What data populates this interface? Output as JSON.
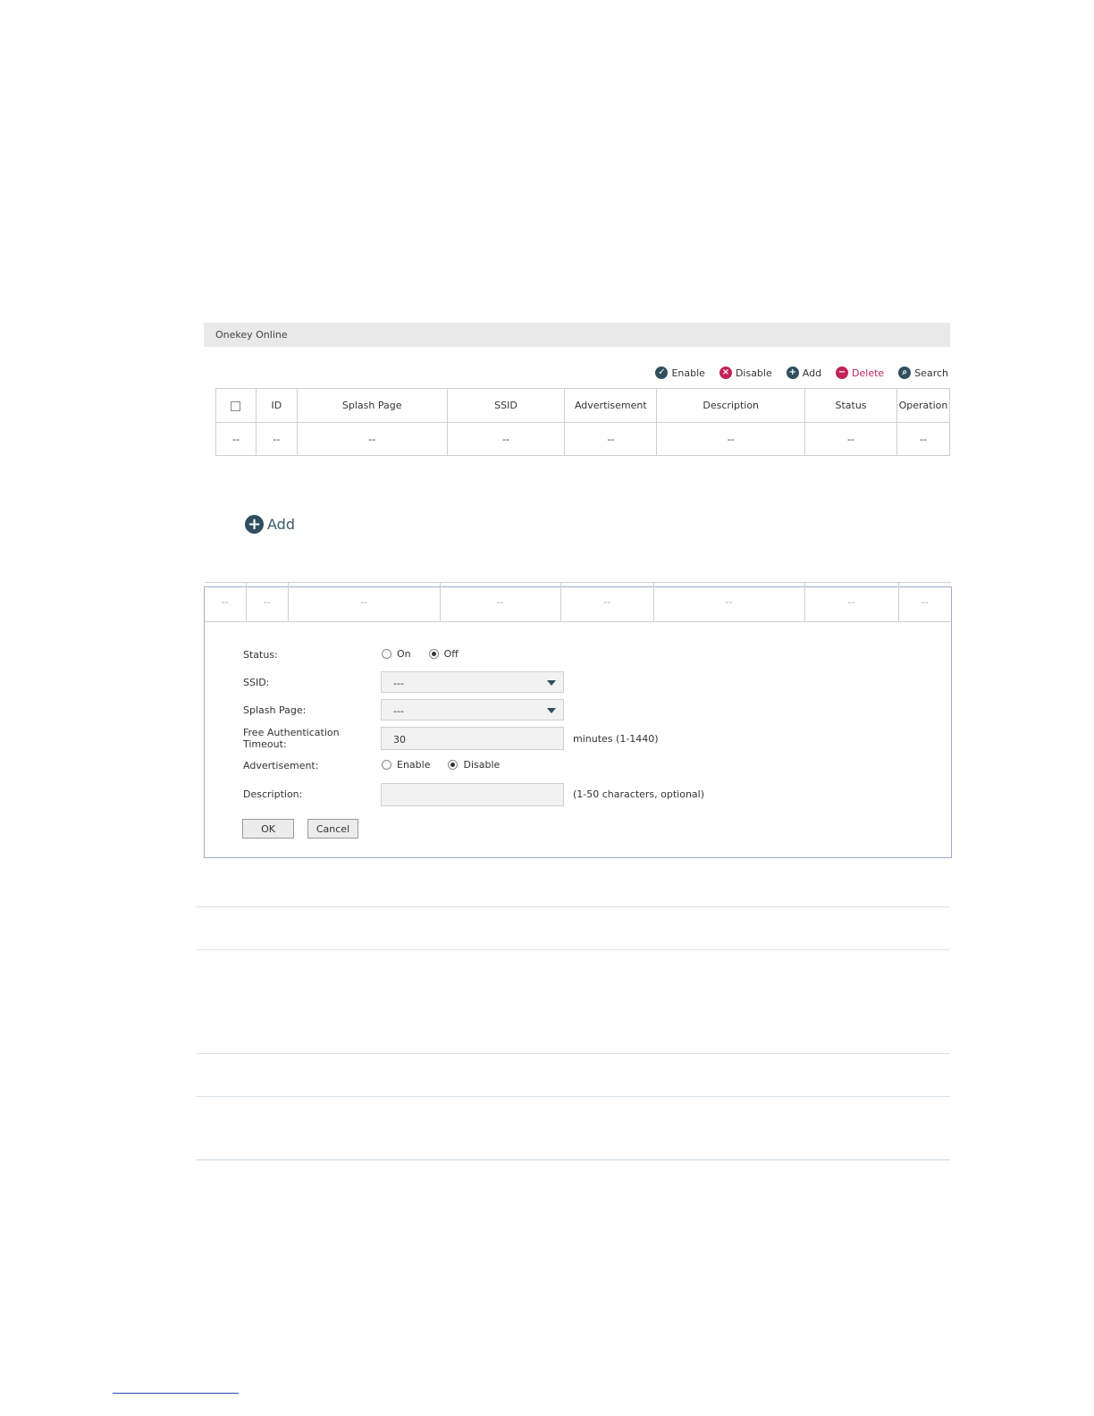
{
  "panel": {
    "title": "Onekey Online"
  },
  "toolbar": {
    "enable": "Enable",
    "disable": "Disable",
    "add": "Add",
    "delete": "Delete",
    "search": "Search"
  },
  "table": {
    "columns": [
      "ID",
      "Splash Page",
      "SSID",
      "Advertisement",
      "Description",
      "Status",
      "Operation"
    ],
    "empty_row": [
      "--",
      "--",
      "--",
      "--",
      "--",
      "--",
      "--",
      "--"
    ]
  },
  "add_button": {
    "label": "Add"
  },
  "form": {
    "status": {
      "label": "Status:",
      "options": [
        "On",
        "Off"
      ],
      "selected": "Off"
    },
    "ssid": {
      "label": "SSID:",
      "value": "---"
    },
    "splash_page": {
      "label": "Splash Page:",
      "value": "---"
    },
    "free_auth_timeout": {
      "label_line1": "Free Authentication",
      "label_line2": "Timeout:",
      "value": "30",
      "hint": "minutes (1-1440)"
    },
    "advertisement": {
      "label": "Advertisement:",
      "options": [
        "Enable",
        "Disable"
      ],
      "selected": "Disable"
    },
    "description": {
      "label": "Description:",
      "value": "",
      "hint": "(1-50 characters, optional)"
    },
    "ok": "OK",
    "cancel": "Cancel"
  },
  "colors": {
    "dark_icon": "#2f4f5f",
    "danger_icon": "#c0245a",
    "panel_border": "#9bb0c8"
  }
}
